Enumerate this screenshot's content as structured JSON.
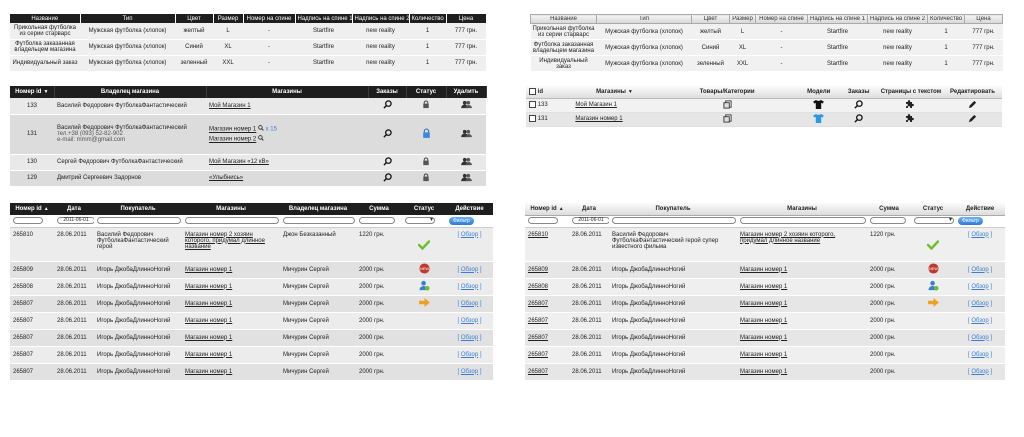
{
  "orders": {
    "headers": [
      "Название",
      "Тип",
      "Цвет",
      "Размер",
      "Номер на спине",
      "Надпись на спине 1",
      "Надпись на спине 2",
      "Количество",
      "Цена"
    ],
    "rows": [
      [
        "Прикольная футболка из серии старварс",
        "Мужская футболка (хлопок)",
        "желтый",
        "L",
        "-",
        "Startfire",
        "new reality",
        "1",
        "777 грн."
      ],
      [
        "Футболка заказанная владельцем магазина",
        "Мужская футболка (хлопок)",
        "Синий",
        "XL",
        "-",
        "Startfire",
        "new reality",
        "1",
        "777 грн."
      ],
      [
        "Индивидуальный заказ",
        "Мужская футболка (хлопок)",
        "зеленный",
        "XXL",
        "-",
        "Startfire",
        "new reality",
        "1",
        "777 грн."
      ]
    ]
  },
  "shops_dark": {
    "headers": {
      "id": "Номер id",
      "sort": "▼",
      "owner": "Владелец магазина",
      "shops": "Магазины",
      "orders": "Заказы",
      "status": "Статус",
      "delete": "Удалить"
    },
    "rows": [
      {
        "id": "133",
        "owner": "Василий Федорович ФутболкаФантастический",
        "contact": [],
        "shops": [
          "Мой Магазин 1"
        ],
        "extra": ""
      },
      {
        "id": "131",
        "owner": "Василий Федорович ФутболкаФантастический",
        "contact": [
          "тел.+38 (093) 52-82-902",
          "e-mail: mmm@gmail.com"
        ],
        "shops": [
          "Магазин номер 1",
          "Магазин номер 2"
        ],
        "extra": "х 15"
      },
      {
        "id": "130",
        "owner": "Сергей Федорович ФутболкаФантастический",
        "contact": [],
        "shops": [
          "Мой Магазин «12 кВ»"
        ],
        "extra": ""
      },
      {
        "id": "129",
        "owner": "Дмитрий Сергеевич Задорнов",
        "contact": [],
        "shops": [
          "«Улыбнись»"
        ],
        "extra": ""
      }
    ]
  },
  "shops_light": {
    "headers": {
      "id": "id",
      "shops": "Магазины",
      "sort": "▼",
      "categories": "Товары/Категории",
      "models": "Модели",
      "orders": "Заказы",
      "pages": "Страницы с текстом",
      "edit": "Редактировать"
    },
    "rows": [
      {
        "id": "133",
        "shop": "Мой Магазин 1"
      },
      {
        "id": "131",
        "shop": "Магазин номер 1"
      }
    ]
  },
  "list_dark": {
    "headers": {
      "id": "Номер id",
      "sort": "▲",
      "date": "Дата",
      "buyer": "Покупатель",
      "shops": "Магазины",
      "owner": "Владелец магазина",
      "sum": "Сумма",
      "status": "Статус",
      "action": "Действие"
    },
    "filter": {
      "date": "2011-06-01",
      "button": "Фильтр"
    },
    "rows": [
      {
        "id": "265810",
        "date": "28.06.2011",
        "buyer": "Василий Федорович ФутболкаФантастический герой",
        "shop": "Магазин номер 2 хозяин которого, придумал длинное название",
        "owner": "Джон Безказанный",
        "sum": "1220 грн.",
        "status": "check",
        "action": "Обзор"
      },
      {
        "id": "265809",
        "date": "28.06.2011",
        "buyer": "Игорь ДжобаДлинноНогий",
        "shop": "Магазин номер 1",
        "owner": "Мичурин Сергей",
        "sum": "2000 грн.",
        "status": "new",
        "action": "Обзор"
      },
      {
        "id": "265808",
        "date": "28.06.2011",
        "buyer": "Игорь ДжобаДлинноНогий",
        "shop": "Магазин номер 1",
        "owner": "Мичурин Сергей",
        "sum": "2000 грн.",
        "status": "user",
        "action": "Обзор"
      },
      {
        "id": "265807",
        "date": "28.06.2011",
        "buyer": "Игорь ДжобаДлинноНогий",
        "shop": "Магазин номер 1",
        "owner": "Мичурин Сергей",
        "sum": "2000 грн.",
        "status": "arrow",
        "action": "Обзор"
      },
      {
        "id": "265807",
        "date": "28.06.2011",
        "buyer": "Игорь ДжобаДлинноНогий",
        "shop": "Магазин номер 1",
        "owner": "Мичурин Сергей",
        "sum": "2000 грн.",
        "status": "",
        "action": "Обзор"
      },
      {
        "id": "265807",
        "date": "28.06.2011",
        "buyer": "Игорь ДжобаДлинноНогий",
        "shop": "Магазин номер 1",
        "owner": "Мичурин Сергей",
        "sum": "2000 грн.",
        "status": "",
        "action": "Обзор"
      },
      {
        "id": "265807",
        "date": "28.06.2011",
        "buyer": "Игорь ДжобаДлинноНогий",
        "shop": "Магазин номер 1",
        "owner": "Мичурин Сергей",
        "sum": "2000 грн.",
        "status": "",
        "action": "Обзор"
      },
      {
        "id": "265807",
        "date": "28.06.2011",
        "buyer": "Игорь ДжобаДлинноНогий",
        "shop": "Магазин номер 1",
        "owner": "Мичурин Сергей",
        "sum": "2000 грн.",
        "status": "",
        "action": "Обзор"
      }
    ]
  },
  "list_light": {
    "headers": {
      "id": "Номер id",
      "sort": "▲",
      "date": "Дата",
      "buyer": "Покупатель",
      "shops": "Магазины",
      "sum": "Сумма",
      "status": "Статус",
      "action": "Действие"
    },
    "filter": {
      "date": "2011-06-01",
      "button": "Фильтр"
    },
    "rows": [
      {
        "id": "265810",
        "date": "28.06.2011",
        "buyer": "Василий Федорович ФутболкаФантастический герой супер известного фильма",
        "shop": "Магазин номер 2 хозяин которого, придумал длинное название",
        "sum": "1220 грн.",
        "status": "check",
        "action": "Обзор"
      },
      {
        "id": "265809",
        "date": "28.06.2011",
        "buyer": "Игорь ДжобаДлинноНогий",
        "shop": "Магазин номер 1",
        "sum": "2000 грн.",
        "status": "new",
        "action": "Обзор"
      },
      {
        "id": "265808",
        "date": "28.06.2011",
        "buyer": "Игорь ДжобаДлинноНогий",
        "shop": "Магазин номер 1",
        "sum": "2000 грн.",
        "status": "user",
        "action": "Обзор"
      },
      {
        "id": "265807",
        "date": "28.06.2011",
        "buyer": "Игорь ДжобаДлинноНогий",
        "shop": "Магазин номер 1",
        "sum": "2000 грн.",
        "status": "arrow",
        "action": "Обзор"
      },
      {
        "id": "265807",
        "date": "28.06.2011",
        "buyer": "Игорь ДжобаДлинноНогий",
        "shop": "Магазин номер 1",
        "sum": "2000 грн.",
        "status": "",
        "action": "Обзор"
      },
      {
        "id": "265807",
        "date": "28.06.2011",
        "buyer": "Игорь ДжобаДлинноНогий",
        "shop": "Магазин номер 1",
        "sum": "2000 грн.",
        "status": "",
        "action": "Обзор"
      },
      {
        "id": "265807",
        "date": "28.06.2011",
        "buyer": "Игорь ДжобаДлинноНогий",
        "shop": "Магазин номер 1",
        "sum": "2000 грн.",
        "status": "",
        "action": "Обзор"
      },
      {
        "id": "265807",
        "date": "28.06.2011",
        "buyer": "Игорь ДжобаДлинноНогий",
        "shop": "Магазин номер 1",
        "sum": "2000 грн.",
        "status": "",
        "action": "Обзор"
      }
    ]
  },
  "icons": {
    "search": "search-icon",
    "lock": "lock-icon",
    "users": "users-icon",
    "pages": "pages-icon",
    "tshirt": "tshirt-icon",
    "puzzle": "puzzle-icon",
    "pencil": "pencil-icon",
    "check": "check-icon",
    "new": "new-badge-icon",
    "user": "user-status-icon",
    "arrow": "arrow-right-icon"
  },
  "colors": {
    "accent": "#3a7ed3",
    "dark_header": "#1e1e1e",
    "check": "#6cbf2c",
    "new_badge": "#c0392b",
    "arrow": "#f0a020"
  }
}
